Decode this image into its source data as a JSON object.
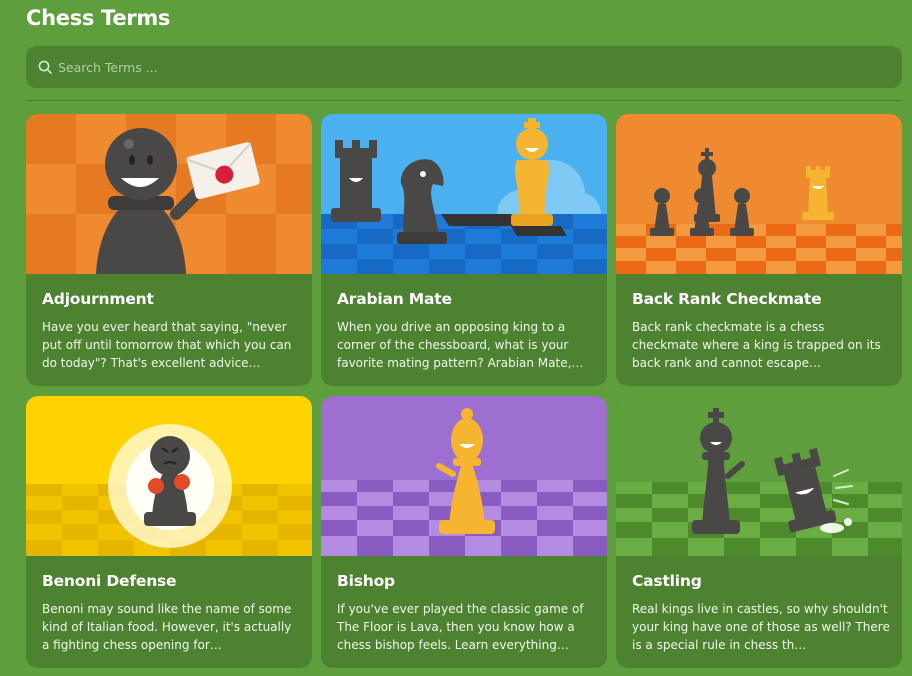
{
  "page": {
    "title": "Chess Terms"
  },
  "search": {
    "placeholder": "Search Terms ..."
  },
  "cards": [
    {
      "title": "Adjournment",
      "desc": "Have you ever heard that saying, \"never put off until tomorrow that which you can do today\"? That's excellent advice…",
      "icon": "pawn-with-envelope"
    },
    {
      "title": "Arabian Mate",
      "desc": "When you drive an opposing king to a corner of the chessboard, what is your favorite mating pattern? Arabian Mate,…",
      "icon": "rook-knight-king"
    },
    {
      "title": "Back Rank Checkmate",
      "desc": "Back rank checkmate is a chess checkmate where a king is trapped on its back rank and cannot escape…",
      "icon": "pawns-and-king"
    },
    {
      "title": "Benoni Defense",
      "desc": "Benoni may sound like the name of some kind of Italian food. However, it's actually a fighting chess opening for…",
      "icon": "boxing-pawn"
    },
    {
      "title": "Bishop",
      "desc": "If you've ever played the classic game of The Floor is Lava, then you know how a chess bishop feels. Learn everything…",
      "icon": "waving-bishop"
    },
    {
      "title": "Castling",
      "desc": "Real kings live in castles, so why shouldn't your king have one of those as well? There is a special rule in chess th…",
      "icon": "king-and-rook"
    }
  ]
}
